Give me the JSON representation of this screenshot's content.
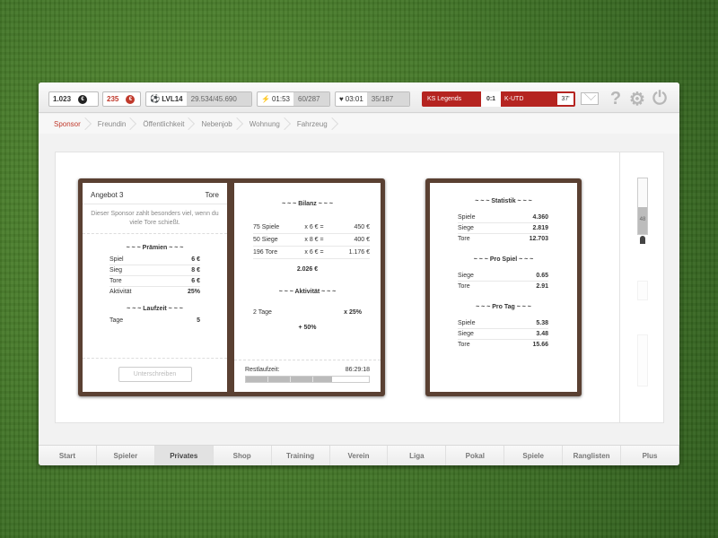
{
  "topbar": {
    "coins": "1.023",
    "coins_symbol": "€",
    "premium": "235",
    "premium_symbol": "€",
    "level": "LVL14",
    "xp": "29.534/45.690",
    "energy_time": "01:53",
    "energy_value": "60/287",
    "health_time": "03:01",
    "health_value": "35/187",
    "match": {
      "team_home": "KS Legends",
      "score": "0:1",
      "team_away": "K-UTD",
      "minute": "37'"
    }
  },
  "subtabs": [
    "Sponsor",
    "Freundin",
    "Öffentlichkeit",
    "Nebenjob",
    "Wohnung",
    "Fahrzeug"
  ],
  "offer": {
    "title": "Angebot 3",
    "type": "Tore",
    "description": "Dieser Sponsor zahlt besonders viel, wenn du viele Tore schießt.",
    "prizes_heading": "~ ~ ~ Prämien ~ ~ ~",
    "prizes": [
      {
        "label": "Spiel",
        "value": "6 €"
      },
      {
        "label": "Sieg",
        "value": "8 €"
      },
      {
        "label": "Tore",
        "value": "6 €"
      },
      {
        "label": "Aktivität",
        "value": "25%"
      }
    ],
    "duration_heading": "~ ~ ~ Laufzeit ~ ~ ~",
    "duration": {
      "label": "Tage",
      "value": "5"
    },
    "sign_button": "Unterschreiben"
  },
  "balance": {
    "heading": "~ ~ ~ Bilanz ~ ~ ~",
    "rows": [
      {
        "count": "75 Spiele",
        "rate": "x 6 € =",
        "total": "450 €"
      },
      {
        "count": "50 Siege",
        "rate": "x 8 € =",
        "total": "400 €"
      },
      {
        "count": "196 Tore",
        "rate": "x 6 € =",
        "total": "1.176 €"
      }
    ],
    "sum": "2.026 €",
    "activity_heading": "~ ~ ~ Aktivität ~ ~ ~",
    "activity_row": {
      "label": "2 Tage",
      "value": "x 25%"
    },
    "activity_result": "+ 50%",
    "remaining_label": "Restlaufzeit:",
    "remaining_value": "86:29:18",
    "remaining_progress": 0.7
  },
  "stats": {
    "heading": "~ ~ ~ Statistik ~ ~ ~",
    "rows": [
      {
        "label": "Spiele",
        "value": "4.360"
      },
      {
        "label": "Siege",
        "value": "2.819"
      },
      {
        "label": "Tore",
        "value": "12.703"
      }
    ],
    "per_game_heading": "~ ~ ~ Pro Spiel ~ ~ ~",
    "per_game": [
      {
        "label": "Siege",
        "value": "0.65"
      },
      {
        "label": "Tore",
        "value": "2.91"
      }
    ],
    "per_day_heading": "~ ~ ~ Pro Tag ~ ~ ~",
    "per_day": [
      {
        "label": "Spiele",
        "value": "5.38"
      },
      {
        "label": "Siege",
        "value": "3.48"
      },
      {
        "label": "Tore",
        "value": "15.66"
      }
    ]
  },
  "side_meter": {
    "value": "48",
    "level": 0.48
  },
  "nav": [
    "Start",
    "Spieler",
    "Privates",
    "Shop",
    "Training",
    "Verein",
    "Liga",
    "Pokal",
    "Spiele",
    "Ranglisten",
    "Plus"
  ],
  "nav_active": "Privates"
}
